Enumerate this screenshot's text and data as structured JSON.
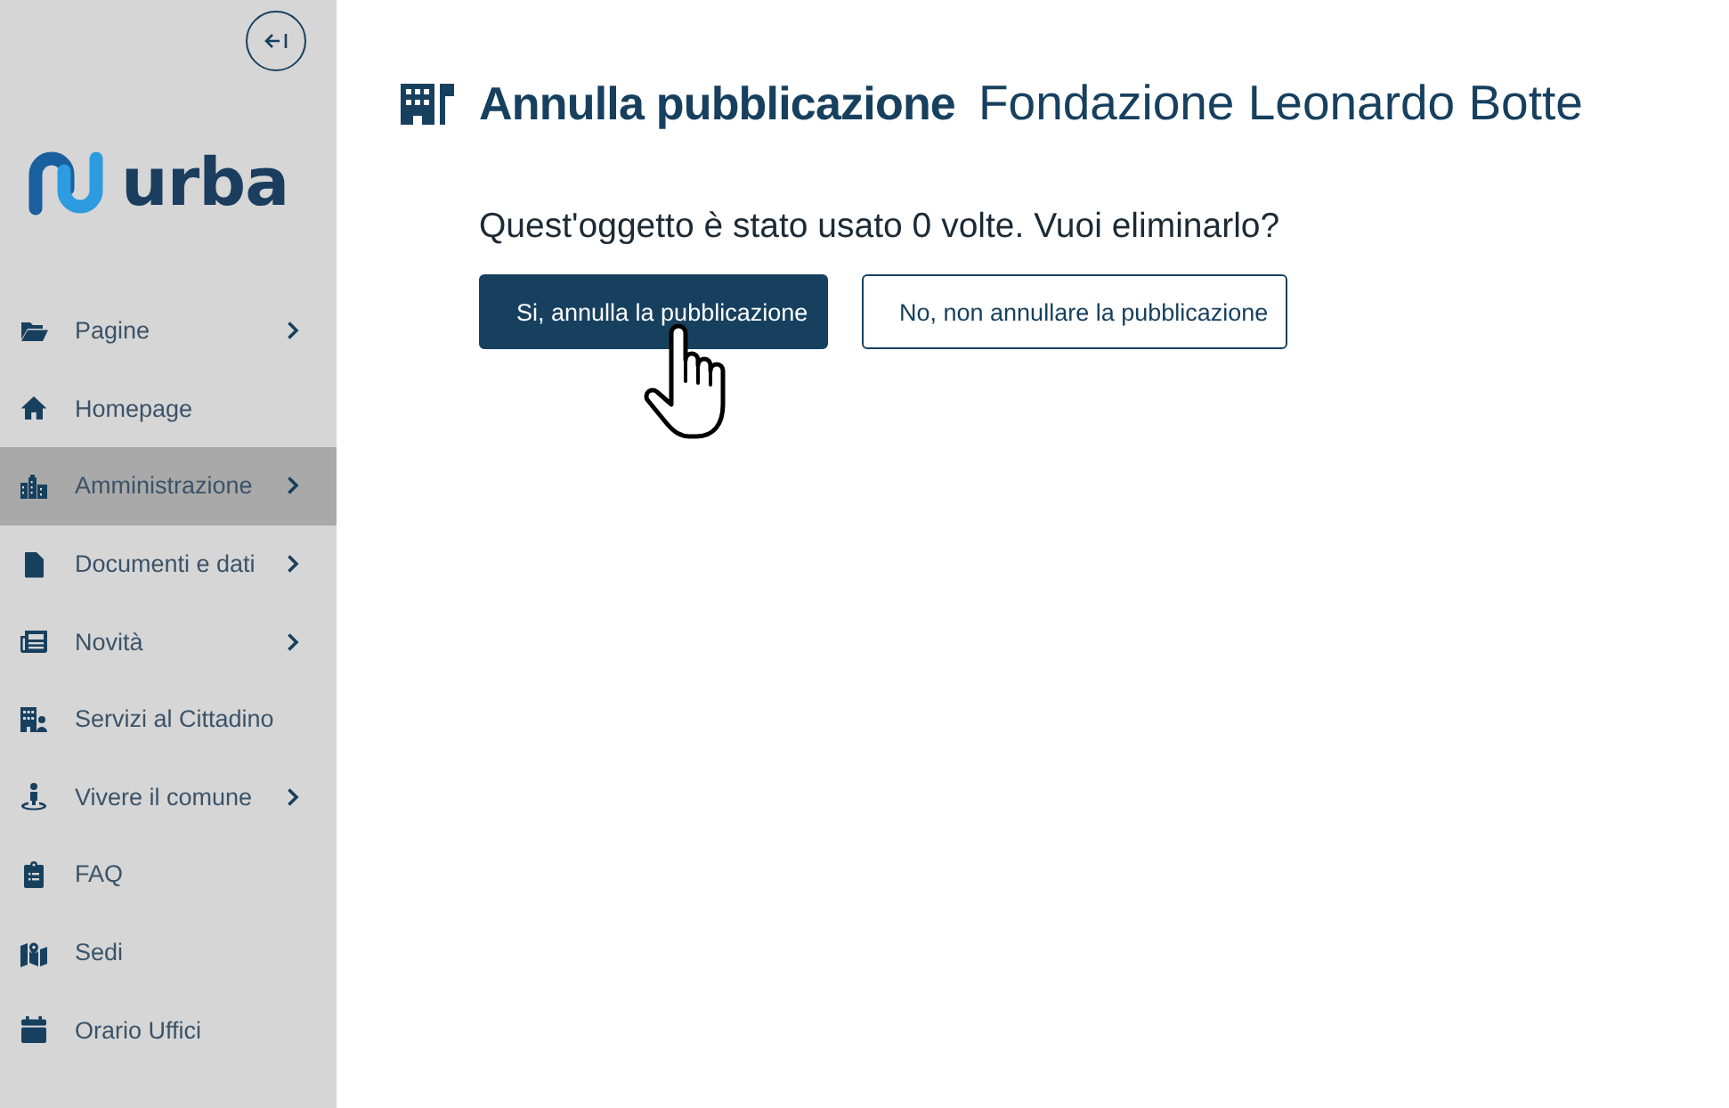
{
  "sidebar": {
    "logo": {
      "text": "urba"
    },
    "items": [
      {
        "label": "Pagine",
        "has_submenu": true,
        "selected": false
      },
      {
        "label": "Homepage",
        "has_submenu": false,
        "selected": false
      },
      {
        "label": "Amministrazione",
        "has_submenu": true,
        "selected": true
      },
      {
        "label": "Documenti e dati",
        "has_submenu": true,
        "selected": false
      },
      {
        "label": "Novità",
        "has_submenu": true,
        "selected": false
      },
      {
        "label": "Servizi al Cittadino",
        "has_submenu": false,
        "selected": false
      },
      {
        "label": "Vivere il comune",
        "has_submenu": true,
        "selected": false
      },
      {
        "label": "FAQ",
        "has_submenu": false,
        "selected": false
      },
      {
        "label": "Sedi",
        "has_submenu": false,
        "selected": false
      },
      {
        "label": "Orario Uffici",
        "has_submenu": false,
        "selected": false
      }
    ]
  },
  "main": {
    "title": {
      "heading": "Annulla pubblicazione",
      "subject": "Fondazione Leonardo Botte"
    },
    "question": "Quest'oggetto è stato usato 0 volte. Vuoi eliminarlo?",
    "buttons": [
      {
        "label": "Si, annulla la pubblicazione",
        "kind": "primary"
      },
      {
        "label": "No, non annullare la pubblicazione",
        "kind": "secondary"
      }
    ]
  }
}
